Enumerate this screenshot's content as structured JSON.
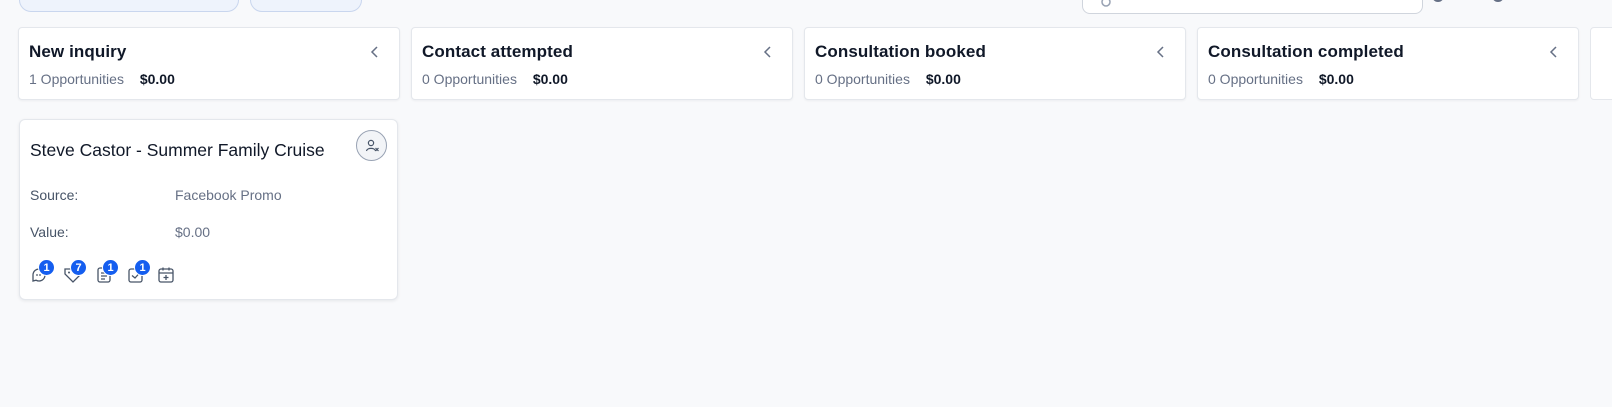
{
  "columns": [
    {
      "title": "New inquiry",
      "count": "1 Opportunities",
      "amount": "$0.00"
    },
    {
      "title": "Contact attempted",
      "count": "0 Opportunities",
      "amount": "$0.00"
    },
    {
      "title": "Consultation booked",
      "count": "0 Opportunities",
      "amount": "$0.00"
    },
    {
      "title": "Consultation completed",
      "count": "0 Opportunities",
      "amount": "$0.00"
    }
  ],
  "card": {
    "title": "Steve Castor - Summer Family Cruise",
    "source_label": "Source:",
    "source_value": "Facebook Promo",
    "value_label": "Value:",
    "value_value": "$0.00",
    "badges": {
      "conversations": "1",
      "tags": "7",
      "notes": "1",
      "tasks": "1"
    }
  },
  "colors": {
    "accent": "#155eef",
    "background": "#f8f9fb"
  },
  "icons": [
    "search-icon",
    "chevron-left-icon",
    "unassigned-user-icon",
    "conversation-icon",
    "tag-icon",
    "note-icon",
    "task-icon",
    "calendar-add-icon"
  ]
}
